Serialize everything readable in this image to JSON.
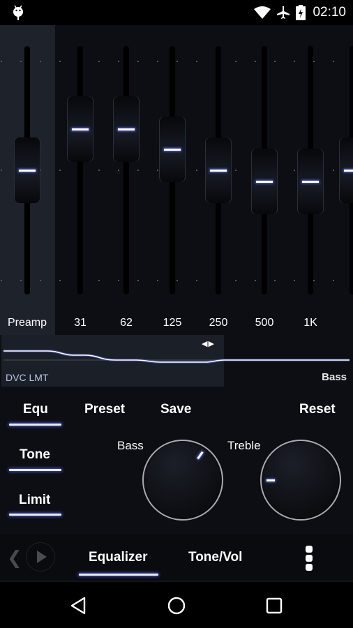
{
  "status_bar": {
    "left_icon": "android-debug-icon",
    "icons": [
      "wifi-icon",
      "airplane-mode-icon",
      "battery-charging-icon"
    ],
    "time": "02:10"
  },
  "equalizer": {
    "bands": [
      {
        "label": "Preamp",
        "value_fraction": 0.0
      },
      {
        "label": "31",
        "value_fraction": 0.38
      },
      {
        "label": "62",
        "value_fraction": 0.38
      },
      {
        "label": "125",
        "value_fraction": 0.19
      },
      {
        "label": "250",
        "value_fraction": 0.0
      },
      {
        "label": "500",
        "value_fraction": -0.1
      },
      {
        "label": "1K",
        "value_fraction": -0.1
      },
      {
        "label": "",
        "value_fraction": 0.0
      }
    ],
    "value_range_note": "fraction of half-range; +1 = top, -1 = bottom"
  },
  "graph": {
    "scroll_arrows": "◀▶",
    "left_label": "DVC LMT",
    "right_label": "Bass"
  },
  "controls": {
    "equ": "Equ",
    "preset": "Preset",
    "save": "Save",
    "reset": "Reset",
    "tone": "Tone",
    "limit": "Limit",
    "bass_label": "Bass",
    "treble_label": "Treble",
    "bass_dial_angle_deg": 35,
    "treble_dial_angle_deg": -90
  },
  "tabbar": {
    "prev": "❮",
    "tabs": [
      {
        "label": "Equalizer",
        "active": true
      },
      {
        "label": "Tone/Vol",
        "active": false
      }
    ]
  },
  "colors": {
    "accent_glow": "#5a63d8",
    "background": "#0c0e13",
    "preamp_panel": "#1e222b"
  }
}
